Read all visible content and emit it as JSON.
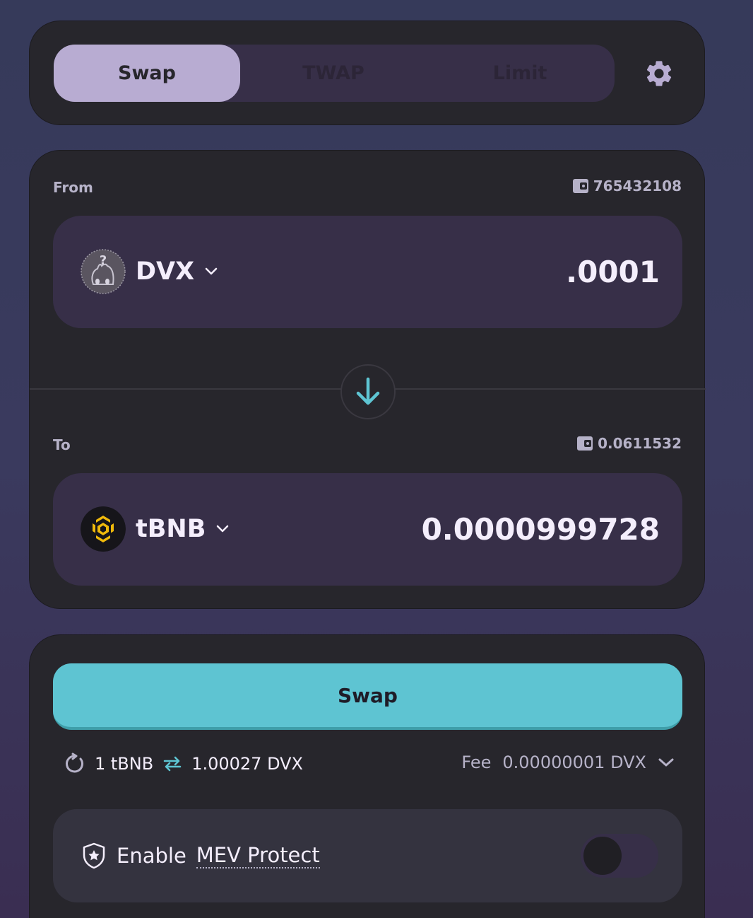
{
  "tabs": [
    {
      "label": "Swap",
      "active": true
    },
    {
      "label": "TWAP",
      "active": false
    },
    {
      "label": "Limit",
      "active": false
    }
  ],
  "settings_icon": "gear-icon",
  "from": {
    "label": "From",
    "balance": "765432108",
    "token": "DVX",
    "amount": ".0001"
  },
  "to": {
    "label": "To",
    "balance": "0.0611532",
    "token": "tBNB",
    "amount": "0.0000999728"
  },
  "swap_button": "Swap",
  "rate": {
    "left": "1 tBNB",
    "right": "1.00027 DVX"
  },
  "fee": {
    "label": "Fee",
    "value": "0.00000001 DVX"
  },
  "mev": {
    "prefix": "Enable",
    "link": "MEV Protect",
    "enabled": false
  },
  "colors": {
    "accent": "#5ec4d2",
    "card": "#27262c",
    "panel": "#372f48",
    "active_tab": "#b8acd2"
  }
}
